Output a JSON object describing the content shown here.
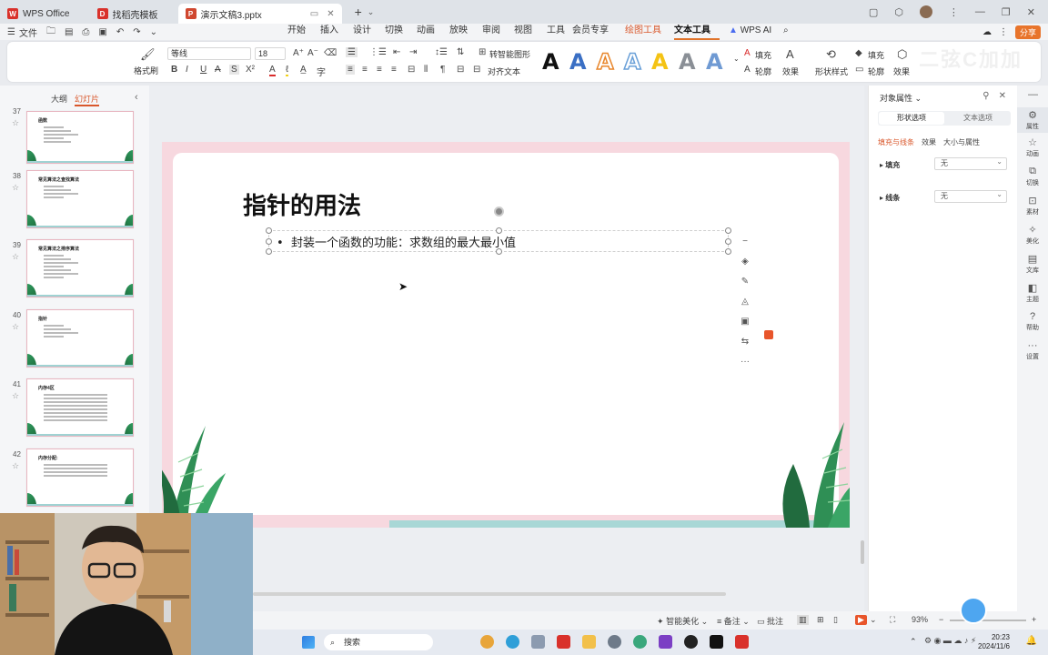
{
  "titlebar": {
    "tabs": [
      {
        "label": "WPS Office",
        "badge_color": "#d9312b"
      },
      {
        "label": "找稻壳模板",
        "badge_color": "#d9312b"
      },
      {
        "label": "演示文稿3.pptx",
        "badge_color": "#d0472f"
      }
    ]
  },
  "menubar": {
    "file": "文件",
    "tabs": [
      "开始",
      "插入",
      "设计",
      "切换",
      "动画",
      "放映",
      "审阅",
      "视图",
      "工具",
      "会员专享",
      "绘图工具",
      "文本工具"
    ],
    "wps_ai": "WPS AI",
    "share": "分享"
  },
  "ribbon": {
    "format_painter": "格式刷",
    "font_name": "等线",
    "font_size": "18",
    "smart_shape": "转智能图形",
    "align_text": "对齐文本",
    "fill": "填充",
    "outline": "轮廓",
    "effects": "效果",
    "shape_style": "形状样式",
    "fill2": "填充",
    "outline2": "轮廓",
    "effects2": "效果",
    "watermark": "二弦C加加"
  },
  "left_panel": {
    "tab_outline": "大纲",
    "tab_slides": "幻灯片",
    "slides": [
      {
        "num": "37",
        "title": "函数"
      },
      {
        "num": "38",
        "title": "常见算法之查找算法"
      },
      {
        "num": "39",
        "title": "常见算法之排序算法"
      },
      {
        "num": "40",
        "title": "指针"
      },
      {
        "num": "41",
        "title": "内存4区"
      },
      {
        "num": "42",
        "title": "内存分配:"
      }
    ]
  },
  "slide": {
    "title": "指针的用法",
    "bullet": "封装一个函数的功能：求数组的最大最小值"
  },
  "right_panel": {
    "title": "对象属性",
    "tab_shape": "形状选项",
    "tab_text": "文本选项",
    "sub_fill_line": "填充与线条",
    "sub_effects": "效果",
    "sub_size": "大小与属性",
    "fill_label": "填充",
    "fill_value": "无",
    "line_label": "线条",
    "line_value": "无"
  },
  "rail": [
    "属性",
    "动画",
    "切换",
    "素材",
    "美化",
    "文库",
    "主题",
    "帮助",
    "设置"
  ],
  "statusbar": {
    "beautify": "智能美化",
    "notes": "备注",
    "comments": "批注",
    "zoom": "93%"
  },
  "taskbar": {
    "search": "搜索",
    "time": "20:23",
    "date": "2024/11/6"
  }
}
